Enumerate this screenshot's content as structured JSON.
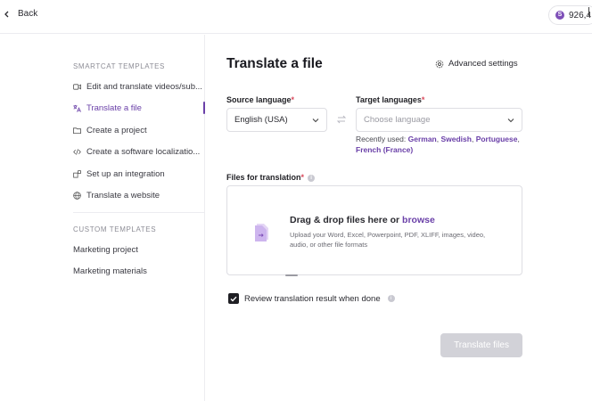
{
  "header": {
    "back_label": "Back",
    "balance": "926,4",
    "coin_symbol": "S"
  },
  "sidebar": {
    "smartcat_title": "SMARTCAT TEMPLATES",
    "items": [
      {
        "label": "Edit and translate videos/sub...",
        "icon": "video-icon"
      },
      {
        "label": "Translate a file",
        "icon": "translate-icon",
        "active": true
      },
      {
        "label": "Create a project",
        "icon": "folder-icon"
      },
      {
        "label": "Create a software localizatio...",
        "icon": "code-icon"
      },
      {
        "label": "Set up an integration",
        "icon": "puzzle-icon"
      },
      {
        "label": "Translate a website",
        "icon": "globe-icon"
      }
    ],
    "custom_title": "CUSTOM TEMPLATES",
    "custom_items": [
      {
        "label": "Marketing project"
      },
      {
        "label": "Marketing materials"
      }
    ]
  },
  "main": {
    "title": "Translate a file",
    "advanced_settings": "Advanced settings",
    "source_label": "Source language",
    "source_value": "English (USA)",
    "target_label": "Target languages",
    "target_placeholder": "Choose language",
    "recently_used_prefix": "Recently used:",
    "recent_languages": [
      "German",
      "Swedish",
      "Portuguese",
      "French (France)"
    ],
    "files_label": "Files for translation",
    "dropzone_text": "Drag & drop files here or",
    "dropzone_browse": "browse",
    "dropzone_subtext": "Upload your Word, Excel, Powerpoint, PDF, XLIFF, images, video, audio, or other file formats",
    "review_label": "Review translation result when done",
    "review_checked": true,
    "submit_label": "Translate files",
    "required_mark": "*"
  },
  "colors": {
    "accent": "#6a40a8",
    "required": "#d94a5c",
    "button_disabled": "#d2d2d8"
  }
}
